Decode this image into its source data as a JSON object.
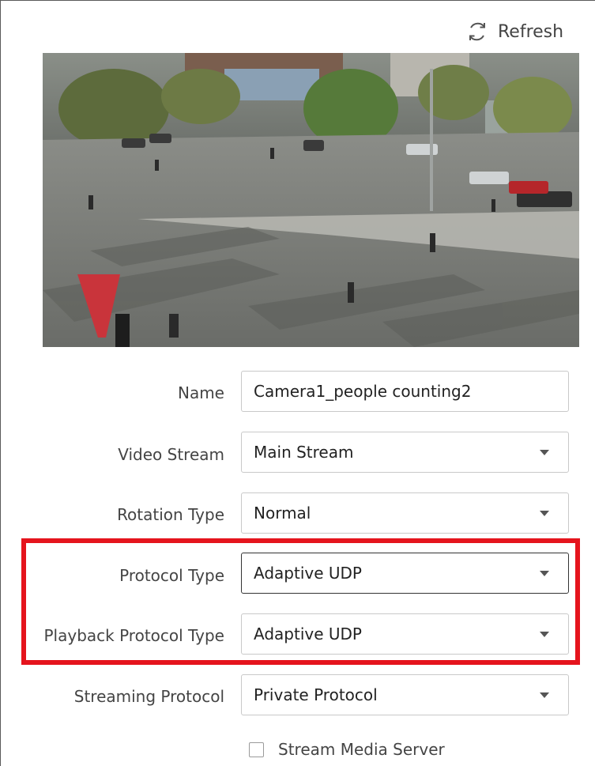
{
  "refresh": {
    "label": "Refresh",
    "icon": "refresh-icon"
  },
  "form": {
    "name": {
      "label": "Name",
      "value": "Camera1_people counting2"
    },
    "video_stream": {
      "label": "Video Stream",
      "value": "Main Stream"
    },
    "rotation_type": {
      "label": "Rotation Type",
      "value": "Normal"
    },
    "protocol_type": {
      "label": "Protocol Type",
      "value": "Adaptive UDP"
    },
    "playback_protocol_type": {
      "label": "Playback Protocol Type",
      "value": "Adaptive UDP"
    },
    "streaming_protocol": {
      "label": "Streaming Protocol",
      "value": "Private Protocol"
    },
    "stream_media_server": {
      "label": "Stream Media Server",
      "checked": false
    }
  },
  "colors": {
    "highlight": "#e5141d",
    "text": "#444444",
    "border": "#c9c9c9"
  }
}
